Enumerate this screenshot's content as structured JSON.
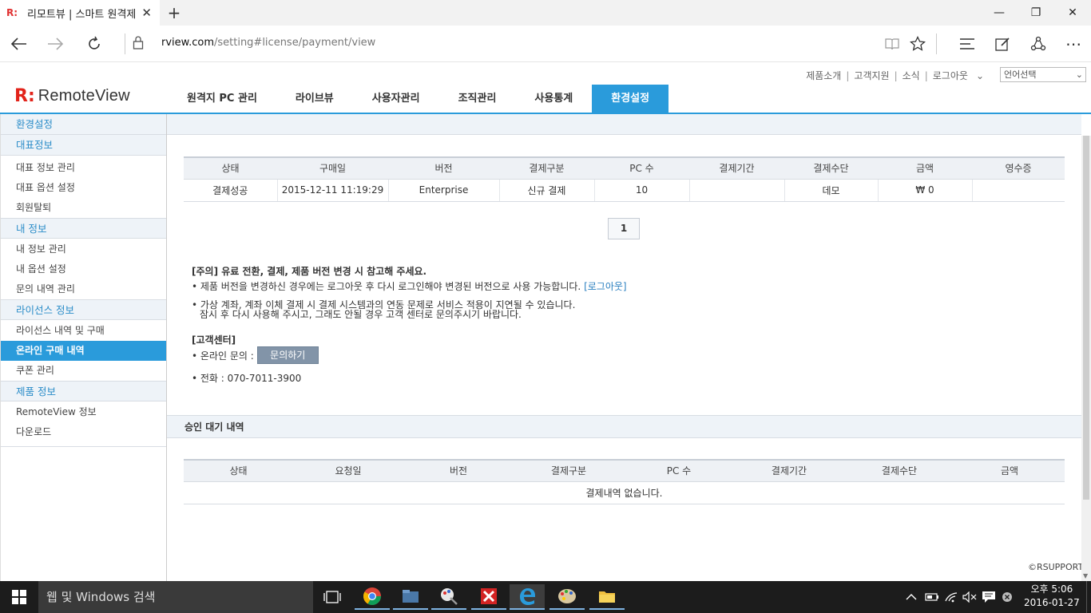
{
  "browser": {
    "tab_title": "리모트뷰 | 스마트 원격제",
    "favicon": "R:",
    "url_host": "rview.com",
    "url_path": "/setting#license/payment/view"
  },
  "header": {
    "top_links": [
      "제품소개",
      "고객지원",
      "소식",
      "로그아웃"
    ],
    "lang_select": "언어선택",
    "logo_mark": "R:",
    "logo_word": "RemoteView",
    "nav": [
      "원격지 PC 관리",
      "라이브뷰",
      "사용자관리",
      "조직관리",
      "사용통계",
      "환경설정"
    ]
  },
  "sidebar": {
    "top": "환경설정",
    "sections": [
      {
        "title": "대표정보",
        "items": [
          "대표 정보 관리",
          "대표 옵션 설정",
          "회원탈퇴"
        ]
      },
      {
        "title": "내 정보",
        "items": [
          "내 정보 관리",
          "내 옵션 설정",
          "문의 내역 관리"
        ]
      },
      {
        "title": "라이선스 정보",
        "items": [
          "라이선스 내역 및 구매",
          "온라인 구매 내역",
          "쿠폰 관리"
        ]
      },
      {
        "title": "제품 정보",
        "items": [
          "RemoteView 정보",
          "다운로드"
        ]
      }
    ]
  },
  "purchase_table": {
    "headers": [
      "상태",
      "구매일",
      "버전",
      "결제구분",
      "PC 수",
      "결제기간",
      "결제수단",
      "금액",
      "영수증"
    ],
    "rows": [
      [
        "결제성공",
        "2015-12-11 11:19:29",
        "Enterprise",
        "신규 결제",
        "10",
        "",
        "데모",
        "₩ 0",
        ""
      ]
    ]
  },
  "pager": {
    "current": "1"
  },
  "notice": {
    "head": "[주의] 유료 전환, 결제, 제품 버전 변경 시 참고해 주세요.",
    "line1": "• 제품 버전을 변경하신 경우에는 로그아웃 후 다시 로그인해야 변경된 버전으로 사용 가능합니다.",
    "line1_link": "[로그아웃]",
    "line2a": "• 가상 계좌, 계좌 이체 결제 시 결제 시스템과의 연동 문제로 서비스 적용이 지연될 수 있습니다.",
    "line2b": "잠시 후 다시 사용해 주시고, 그래도 안될 경우 고객 센터로 문의주시기 바랍니다."
  },
  "customer_center": {
    "head": "[고객센터]",
    "online_label": "• 온라인 문의 :",
    "inquiry_button": "문의하기",
    "phone": "• 전화 : 070-7011-3900"
  },
  "pending": {
    "title": "승인 대기 내역",
    "headers": [
      "상태",
      "요청일",
      "버전",
      "결제구분",
      "PC 수",
      "결제기간",
      "결제수단",
      "금액"
    ],
    "empty": "결제내역 없습니다."
  },
  "copyright": "©RSUPPORT",
  "taskbar": {
    "search_placeholder": "웹 및 Windows 검색",
    "time": "오후 5:06",
    "date": "2016-01-27"
  }
}
